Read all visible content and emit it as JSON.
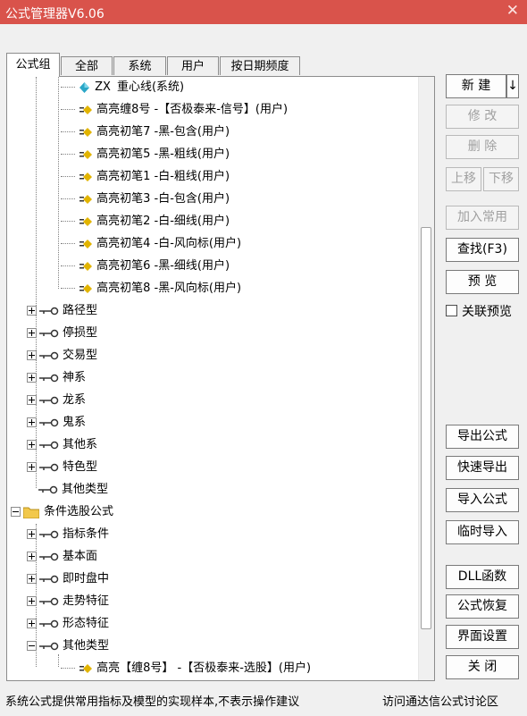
{
  "window": {
    "title": "公式管理器V6.06",
    "close_glyph": "✕"
  },
  "tabs": [
    "公式组",
    "全部",
    "系统",
    "用户",
    "按日期频度"
  ],
  "tree": {
    "leaves": [
      {
        "prefix": "ZX",
        "label": "重心线(系统)",
        "icon": "formula-zx-icon"
      },
      {
        "label": "高亮缠8号  -【否极泰来-信号】(用户)",
        "icon": "formula-eq-icon"
      },
      {
        "label": "高亮初笔7  -黑-包含(用户)",
        "icon": "formula-eq-icon"
      },
      {
        "label": "高亮初笔5  -黑-粗线(用户)",
        "icon": "formula-eq-icon"
      },
      {
        "label": "高亮初笔1  -白-粗线(用户)",
        "icon": "formula-eq-icon"
      },
      {
        "label": "高亮初笔3  -白-包含(用户)",
        "icon": "formula-eq-icon"
      },
      {
        "label": "高亮初笔2  -白-细线(用户)",
        "icon": "formula-eq-icon"
      },
      {
        "label": "高亮初笔4  -白-风向标(用户)",
        "icon": "formula-eq-icon"
      },
      {
        "label": "高亮初笔6  -黑-细线(用户)",
        "icon": "formula-eq-icon"
      },
      {
        "label": "高亮初笔8  -黑-风向标(用户)",
        "icon": "formula-eq-icon"
      }
    ],
    "groups_a": [
      "路径型",
      "停损型",
      "交易型",
      "神系",
      "龙系",
      "鬼系",
      "其他系",
      "特色型",
      "其他类型"
    ],
    "folder": "条件选股公式",
    "groups_b": [
      "指标条件",
      "基本面",
      "即时盘中",
      "走势特征",
      "形态特征",
      "其他类型"
    ],
    "last_leaf": "高亮【缠8号】  -【否极泰来-选股】(用户)"
  },
  "buttons": {
    "new": "新 建",
    "new_arrow": "↓",
    "modify": "修 改",
    "delete": "删 除",
    "move_up": "上移",
    "move_down": "下移",
    "add_common": "加入常用",
    "find": "查找(F3)",
    "preview": "预 览",
    "linked_preview": "关联预览",
    "export": "导出公式",
    "quick_export": "快速导出",
    "import": "导入公式",
    "temp_import": "临时导入",
    "dll": "DLL函数",
    "restore": "公式恢复",
    "ui_settings": "界面设置",
    "close": "关 闭"
  },
  "status": {
    "left": "系统公式提供常用指标及模型的实现样本,不表示操作建议",
    "right": "访问通达信公式讨论区"
  },
  "colors": {
    "titlebar": "#d9534b",
    "window_bg": "#f0f0f0",
    "disabled_text": "#a0a0a0"
  }
}
